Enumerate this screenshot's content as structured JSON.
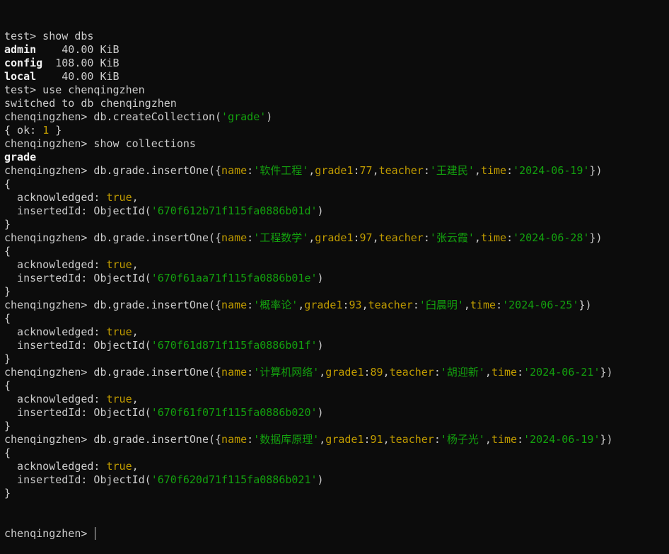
{
  "colors": {
    "background": "#0c0c0c",
    "text": "#cccccc",
    "key": "#c19c00",
    "string": "#13a10e"
  },
  "lines": [
    [
      {
        "t": "test> show dbs"
      }
    ],
    [
      {
        "t": "admin",
        "c": "bold"
      },
      {
        "t": "    40.00 KiB"
      }
    ],
    [
      {
        "t": "config",
        "c": "bold"
      },
      {
        "t": "  108.00 KiB"
      }
    ],
    [
      {
        "t": "local",
        "c": "bold"
      },
      {
        "t": "    40.00 KiB"
      }
    ],
    [
      {
        "t": "test> use chenqingzhen"
      }
    ],
    [
      {
        "t": "switched to db chenqingzhen"
      }
    ],
    [
      {
        "t": "chenqingzhen> db.createCollection("
      },
      {
        "t": "'grade'",
        "c": "str"
      },
      {
        "t": ")"
      }
    ],
    [
      {
        "t": "{ ok: "
      },
      {
        "t": "1",
        "c": "kw"
      },
      {
        "t": " }"
      }
    ],
    [
      {
        "t": "chenqingzhen> show collections"
      }
    ],
    [
      {
        "t": "grade",
        "c": "bold"
      }
    ],
    [
      {
        "t": "chenqingzhen> db.grade.insertOne({"
      },
      {
        "t": "name",
        "c": "kw"
      },
      {
        "t": ":"
      },
      {
        "t": "'软件工程'",
        "c": "str"
      },
      {
        "t": ","
      },
      {
        "t": "grade1",
        "c": "kw"
      },
      {
        "t": ":"
      },
      {
        "t": "77",
        "c": "kw"
      },
      {
        "t": ","
      },
      {
        "t": "teacher",
        "c": "kw"
      },
      {
        "t": ":"
      },
      {
        "t": "'王建民'",
        "c": "str"
      },
      {
        "t": ","
      },
      {
        "t": "time",
        "c": "kw"
      },
      {
        "t": ":"
      },
      {
        "t": "'2024-06-19'",
        "c": "str"
      },
      {
        "t": "})"
      }
    ],
    [
      {
        "t": "{"
      }
    ],
    [
      {
        "t": "  acknowledged: "
      },
      {
        "t": "true",
        "c": "kw"
      },
      {
        "t": ","
      }
    ],
    [
      {
        "t": "  insertedId: ObjectId("
      },
      {
        "t": "'670f612b71f115fa0886b01d'",
        "c": "str"
      },
      {
        "t": ")"
      }
    ],
    [
      {
        "t": "}"
      }
    ],
    [
      {
        "t": "chenqingzhen> db.grade.insertOne({"
      },
      {
        "t": "name",
        "c": "kw"
      },
      {
        "t": ":"
      },
      {
        "t": "'工程数学'",
        "c": "str"
      },
      {
        "t": ","
      },
      {
        "t": "grade1",
        "c": "kw"
      },
      {
        "t": ":"
      },
      {
        "t": "97",
        "c": "kw"
      },
      {
        "t": ","
      },
      {
        "t": "teacher",
        "c": "kw"
      },
      {
        "t": ":"
      },
      {
        "t": "'张云霞'",
        "c": "str"
      },
      {
        "t": ","
      },
      {
        "t": "time",
        "c": "kw"
      },
      {
        "t": ":"
      },
      {
        "t": "'2024-06-28'",
        "c": "str"
      },
      {
        "t": "})"
      }
    ],
    [
      {
        "t": "{"
      }
    ],
    [
      {
        "t": "  acknowledged: "
      },
      {
        "t": "true",
        "c": "kw"
      },
      {
        "t": ","
      }
    ],
    [
      {
        "t": "  insertedId: ObjectId("
      },
      {
        "t": "'670f61aa71f115fa0886b01e'",
        "c": "str"
      },
      {
        "t": ")"
      }
    ],
    [
      {
        "t": "}"
      }
    ],
    [
      {
        "t": "chenqingzhen> db.grade.insertOne({"
      },
      {
        "t": "name",
        "c": "kw"
      },
      {
        "t": ":"
      },
      {
        "t": "'概率论'",
        "c": "str"
      },
      {
        "t": ","
      },
      {
        "t": "grade1",
        "c": "kw"
      },
      {
        "t": ":"
      },
      {
        "t": "93",
        "c": "kw"
      },
      {
        "t": ","
      },
      {
        "t": "teacher",
        "c": "kw"
      },
      {
        "t": ":"
      },
      {
        "t": "'臼晨明'",
        "c": "str"
      },
      {
        "t": ","
      },
      {
        "t": "time",
        "c": "kw"
      },
      {
        "t": ":"
      },
      {
        "t": "'2024-06-25'",
        "c": "str"
      },
      {
        "t": "})"
      }
    ],
    [
      {
        "t": "{"
      }
    ],
    [
      {
        "t": "  acknowledged: "
      },
      {
        "t": "true",
        "c": "kw"
      },
      {
        "t": ","
      }
    ],
    [
      {
        "t": "  insertedId: ObjectId("
      },
      {
        "t": "'670f61d871f115fa0886b01f'",
        "c": "str"
      },
      {
        "t": ")"
      }
    ],
    [
      {
        "t": "}"
      }
    ],
    [
      {
        "t": "chenqingzhen> db.grade.insertOne({"
      },
      {
        "t": "name",
        "c": "kw"
      },
      {
        "t": ":"
      },
      {
        "t": "'计算机网络'",
        "c": "str"
      },
      {
        "t": ","
      },
      {
        "t": "grade1",
        "c": "kw"
      },
      {
        "t": ":"
      },
      {
        "t": "89",
        "c": "kw"
      },
      {
        "t": ","
      },
      {
        "t": "teacher",
        "c": "kw"
      },
      {
        "t": ":"
      },
      {
        "t": "'胡迎新'",
        "c": "str"
      },
      {
        "t": ","
      },
      {
        "t": "time",
        "c": "kw"
      },
      {
        "t": ":"
      },
      {
        "t": "'2024-06-21'",
        "c": "str"
      },
      {
        "t": "})"
      }
    ],
    [
      {
        "t": "{"
      }
    ],
    [
      {
        "t": "  acknowledged: "
      },
      {
        "t": "true",
        "c": "kw"
      },
      {
        "t": ","
      }
    ],
    [
      {
        "t": "  insertedId: ObjectId("
      },
      {
        "t": "'670f61f071f115fa0886b020'",
        "c": "str"
      },
      {
        "t": ")"
      }
    ],
    [
      {
        "t": "}"
      }
    ],
    [
      {
        "t": "chenqingzhen> db.grade.insertOne({"
      },
      {
        "t": "name",
        "c": "kw"
      },
      {
        "t": ":"
      },
      {
        "t": "'数据库原理'",
        "c": "str"
      },
      {
        "t": ","
      },
      {
        "t": "grade1",
        "c": "kw"
      },
      {
        "t": ":"
      },
      {
        "t": "91",
        "c": "kw"
      },
      {
        "t": ","
      },
      {
        "t": "teacher",
        "c": "kw"
      },
      {
        "t": ":"
      },
      {
        "t": "'杨子光'",
        "c": "str"
      },
      {
        "t": ","
      },
      {
        "t": "time",
        "c": "kw"
      },
      {
        "t": ":"
      },
      {
        "t": "'2024-06-19'",
        "c": "str"
      },
      {
        "t": "})"
      }
    ],
    [
      {
        "t": "{"
      }
    ],
    [
      {
        "t": "  acknowledged: "
      },
      {
        "t": "true",
        "c": "kw"
      },
      {
        "t": ","
      }
    ],
    [
      {
        "t": "  insertedId: ObjectId("
      },
      {
        "t": "'670f620d71f115fa0886b021'",
        "c": "str"
      },
      {
        "t": ")"
      }
    ],
    [
      {
        "t": "}"
      }
    ]
  ],
  "prompt": {
    "text": "chenqingzhen> ",
    "input_value": ""
  }
}
